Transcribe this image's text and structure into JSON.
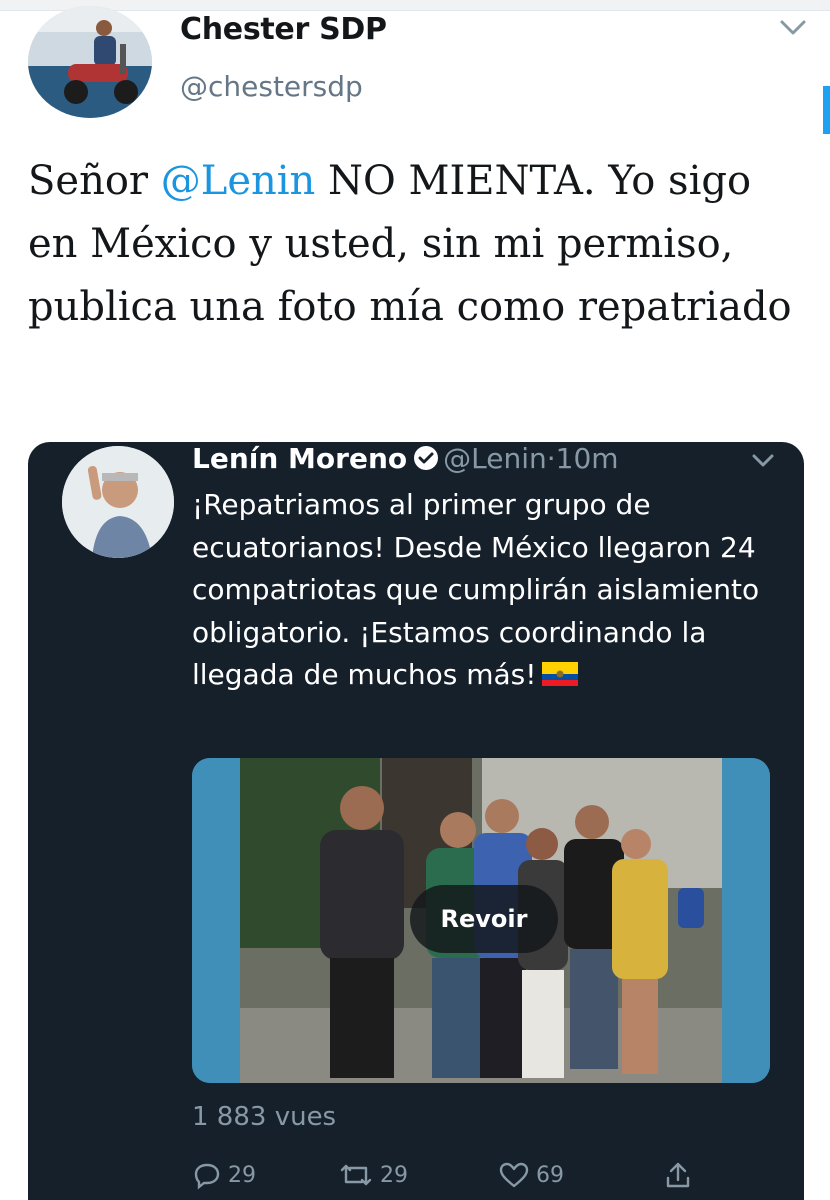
{
  "tweet": {
    "author": {
      "name": "Chester SDP",
      "handle": "@chestersdp",
      "avatar_icon": "person-on-scooter-avatar"
    },
    "text_parts": [
      {
        "text": "Señor ",
        "type": "text"
      },
      {
        "text": "@Lenin",
        "type": "mention"
      },
      {
        "text": " NO MIENTA. Yo sigo en México y usted, sin mi permiso, publica una foto mía como repatriado",
        "type": "text"
      }
    ],
    "colors": {
      "mention": "#1b95e0",
      "background": "#ffffff"
    }
  },
  "quoted_tweet": {
    "author": {
      "name": "Lenín Moreno",
      "handle": "@Lenin",
      "separator": "·",
      "time": "10m",
      "verified_icon": "verified-badge-icon"
    },
    "text": "¡Repatriamos al primer grupo de ecuatorianos! Desde México llegaron 24 compatriotas que cumplirán aislamiento obligatorio. ¡Estamos coordinando la llegada de muchos más!",
    "emoji": "ecuador-flag-icon",
    "media": {
      "button_label": "Revoir"
    },
    "views": "1 883 vues",
    "actions": {
      "replies": "29",
      "retweets": "29",
      "likes": "69"
    },
    "colors": {
      "background": "#15202b",
      "muted": "#8899a6"
    }
  }
}
